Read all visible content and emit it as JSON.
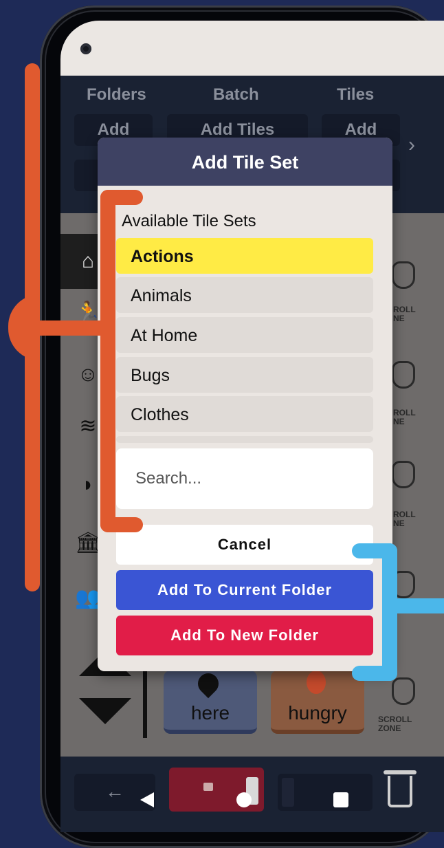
{
  "header": {
    "columns": [
      "Folders",
      "Batch",
      "Tiles"
    ],
    "buttons": [
      "Add",
      "Add Tiles",
      "Add"
    ]
  },
  "modal": {
    "title": "Add Tile Set",
    "list_heading": "Available Tile Sets",
    "items": [
      "Actions",
      "Animals",
      "At Home",
      "Bugs",
      "Clothes"
    ],
    "selected_item": "Actions",
    "search_placeholder": "Search...",
    "cancel_label": "Cancel",
    "add_current_label": "Add To Current Folder",
    "add_new_label": "Add To New Folder"
  },
  "tiles": [
    "here",
    "hungry"
  ],
  "scroll_zone": {
    "line1": "SCROLL",
    "line2": "ZONE",
    "partial1": "ROLL",
    "partial2": "NE"
  },
  "colors": {
    "background": "#1e2a57",
    "modal_header": "#3e4263",
    "selected": "#ffeb45",
    "primary": "#3a55d4",
    "danger": "#e11d48",
    "annotation_orange": "#e05a2f",
    "annotation_blue": "#4bb7ea"
  }
}
